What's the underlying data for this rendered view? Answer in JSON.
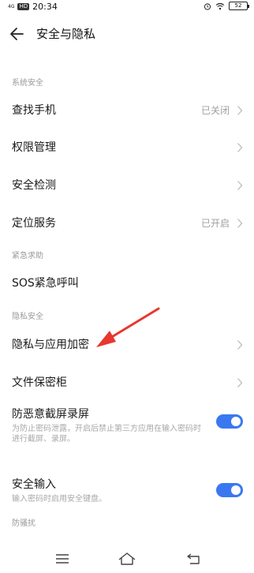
{
  "status_bar": {
    "network": "4G",
    "hd": "HD",
    "time": "20:34",
    "battery": "52",
    "icons": [
      "alarm-icon",
      "wifi-icon",
      "battery-icon"
    ]
  },
  "header": {
    "title": "安全与隐私",
    "back_icon": "back-arrow-icon"
  },
  "sections": {
    "system_security": "系统安全",
    "emergency": "紧急求助",
    "privacy_security": "隐私安全",
    "anti_harassment": "防骚扰"
  },
  "rows": {
    "find_phone": {
      "label": "查找手机",
      "value": "已关闭"
    },
    "permission": {
      "label": "权限管理"
    },
    "security_check": {
      "label": "安全检测"
    },
    "location": {
      "label": "定位服务",
      "value": "已开启"
    },
    "sos": {
      "label": "SOS紧急呼叫"
    },
    "privacy_encrypt": {
      "label": "隐私与应用加密"
    },
    "file_safe": {
      "label": "文件保密柜"
    },
    "anti_capture": {
      "label": "防恶意截屏录屏",
      "desc": "为防止密码泄露，开启后禁止第三方应用在输入密码时进行截屏、录屏。",
      "enabled": true
    },
    "secure_input": {
      "label": "安全输入",
      "desc": "输入密码时启用安全键盘。",
      "enabled": true
    }
  },
  "colors": {
    "accent": "#3a78f2",
    "annotation": "#e8372f",
    "secondary_text": "#a0a0a0"
  },
  "nav_bar": {
    "icons": [
      "menu-icon",
      "home-icon",
      "back-icon"
    ]
  }
}
